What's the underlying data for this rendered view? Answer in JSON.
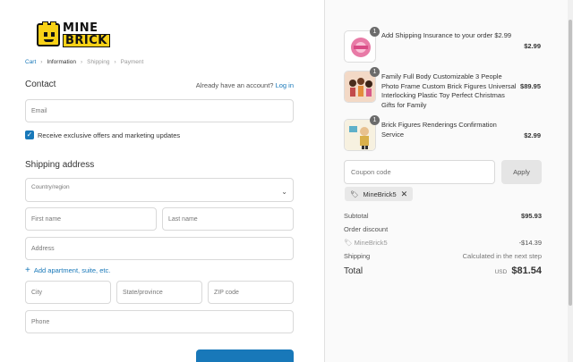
{
  "brand": {
    "line1": "MINE",
    "line2": "BRICK"
  },
  "breadcrumb": [
    "Cart",
    "Information",
    "Shipping",
    "Payment"
  ],
  "contact": {
    "title": "Contact",
    "account_prompt": "Already have an account?",
    "login": "Log in",
    "email_placeholder": "Email",
    "offers_label": "Receive exclusive offers and marketing updates"
  },
  "shipping": {
    "title": "Shipping address",
    "country_label": "Country/region",
    "first_name": "First name",
    "last_name": "Last name",
    "address": "Address",
    "add_apt": "Add apartment, suite, etc.",
    "city": "City",
    "state": "State/province",
    "zip": "ZIP code",
    "phone": "Phone"
  },
  "items": [
    {
      "qty": "1",
      "name": "Add Shipping Insurance to your order $2.99",
      "price": "$2.99"
    },
    {
      "qty": "1",
      "name": "Family Full Body Customizable 3 People Photo Frame Custom Brick Figures Universal Interlocking Plastic Toy Perfect Christmas Gifts for Family",
      "price": "$89.95"
    },
    {
      "qty": "1",
      "name": "Brick Figures Renderings Confirmation Service",
      "price": "$2.99"
    }
  ],
  "coupon": {
    "placeholder": "Coupon code",
    "apply": "Apply",
    "applied_code": "MineBrick5"
  },
  "summary": {
    "subtotal_label": "Subtotal",
    "subtotal": "$95.93",
    "discount_label": "Order discount",
    "discount_code": "MineBrick5",
    "discount": "-$14.39",
    "shipping_label": "Shipping",
    "shipping": "Calculated in the next step",
    "total_label": "Total",
    "currency": "USD",
    "total": "$81.54"
  },
  "colors": {
    "accent": "#1878b9",
    "logo_yellow": "#f7d117"
  }
}
